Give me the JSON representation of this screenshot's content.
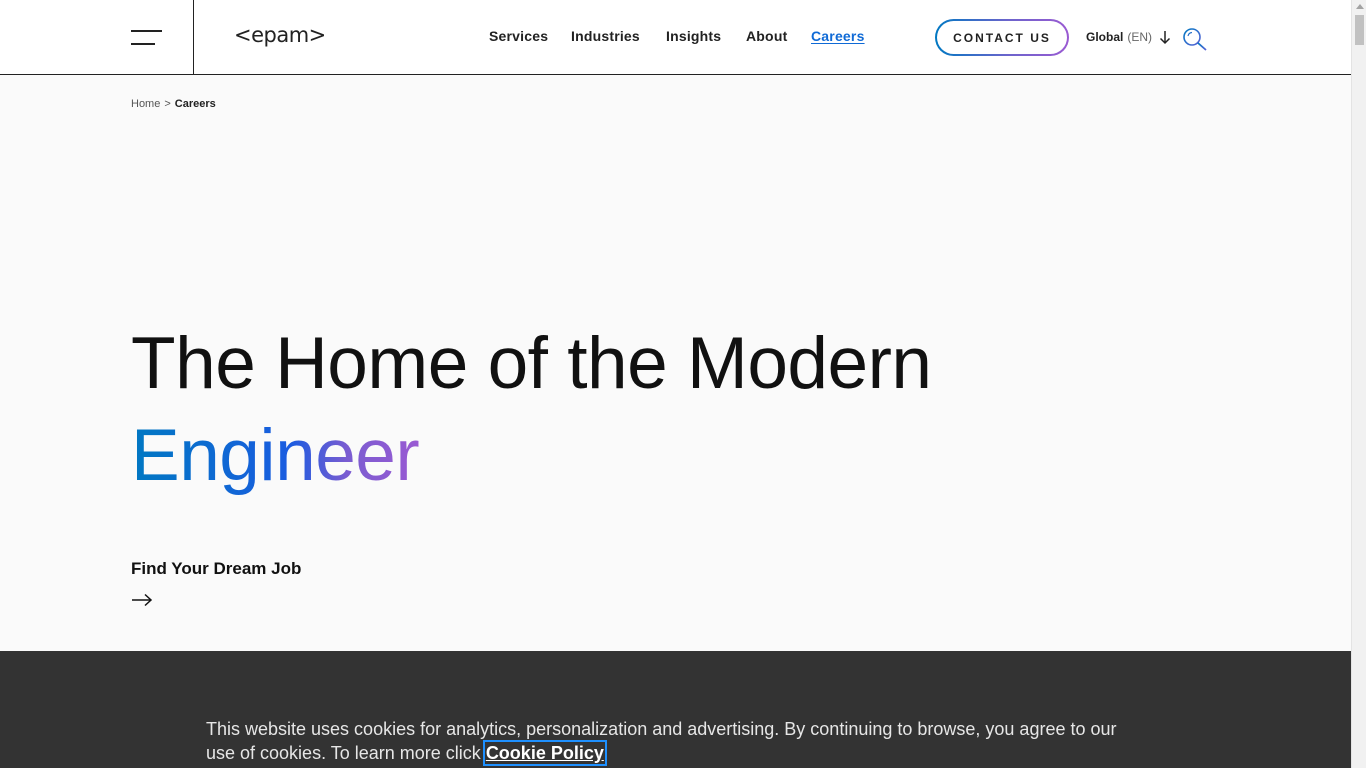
{
  "header": {
    "logo_text": "<epam>",
    "nav": [
      {
        "label": "Services",
        "active": false
      },
      {
        "label": "Industries",
        "active": false
      },
      {
        "label": "Insights",
        "active": false
      },
      {
        "label": "About",
        "active": false
      },
      {
        "label": "Careers",
        "active": true
      }
    ],
    "contact_label": "CONTACT US",
    "region": "Global",
    "language_code": "(EN)",
    "icons": [
      "hamburger-menu-icon",
      "arrow-down-icon",
      "search-icon"
    ]
  },
  "breadcrumb": {
    "home": "Home",
    "separator": ">",
    "current": "Careers"
  },
  "hero": {
    "title_line1": "The Home of the Modern",
    "title_line2": "Engineer",
    "cta_label": "Find Your Dream Job",
    "cta_icon": "arrow-right-icon"
  },
  "cookie_banner": {
    "text": "This website uses cookies for analytics, personalization and advertising. By continuing to browse, you agree to our use of cookies. To learn more click",
    "link_label": "Cookie Policy"
  },
  "colors": {
    "accent_blue": "#0f6ad6",
    "gradient_start": "#0078c2",
    "gradient_end": "#9a5ad2",
    "banner_bg": "#333333"
  }
}
